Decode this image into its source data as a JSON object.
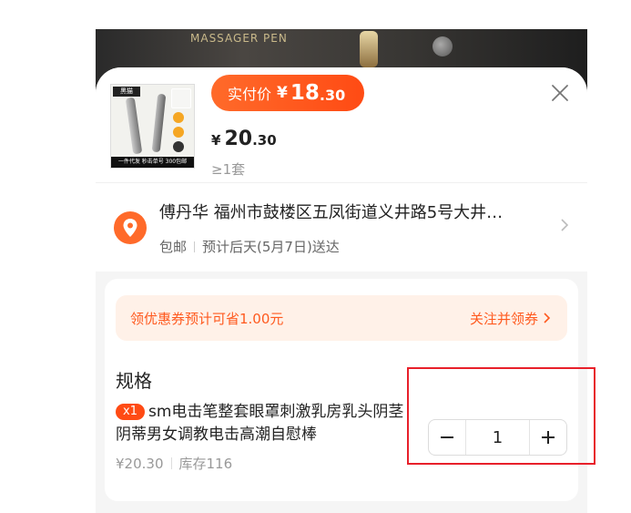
{
  "backdrop": {
    "brand_text": "MASSAGER PEN"
  },
  "product": {
    "thumb_badge": "黑猫",
    "thumb_strip": "一件代发  秒击单号  300包邮",
    "pay_label": "实付价",
    "pay_currency": "¥",
    "pay_int": "18",
    "pay_dec": ".30",
    "orig_currency": "¥",
    "orig_int": "20",
    "orig_dec": ".30",
    "min_qty": "≥1套"
  },
  "address": {
    "line": "傅丹华 福州市鼓楼区五凤街道义井路5号大井…",
    "shipping": "包邮",
    "delivery": "预计后天(5月7日)送达"
  },
  "coupon": {
    "text": "领优惠券预计可省1.00元",
    "action": "关注并领券"
  },
  "spec": {
    "title": "规格",
    "qty_badge": "x1",
    "item_name": "sm电击笔整套眼罩刺激乳房乳头阴茎阴蒂男女调教电击高潮自慰棒",
    "price": "¥20.30",
    "stock": "库存116"
  },
  "stepper": {
    "value": "1",
    "minus": "−",
    "plus": "+"
  },
  "colors": {
    "accent": "#ff4b14",
    "annotation": "#e8202a"
  }
}
